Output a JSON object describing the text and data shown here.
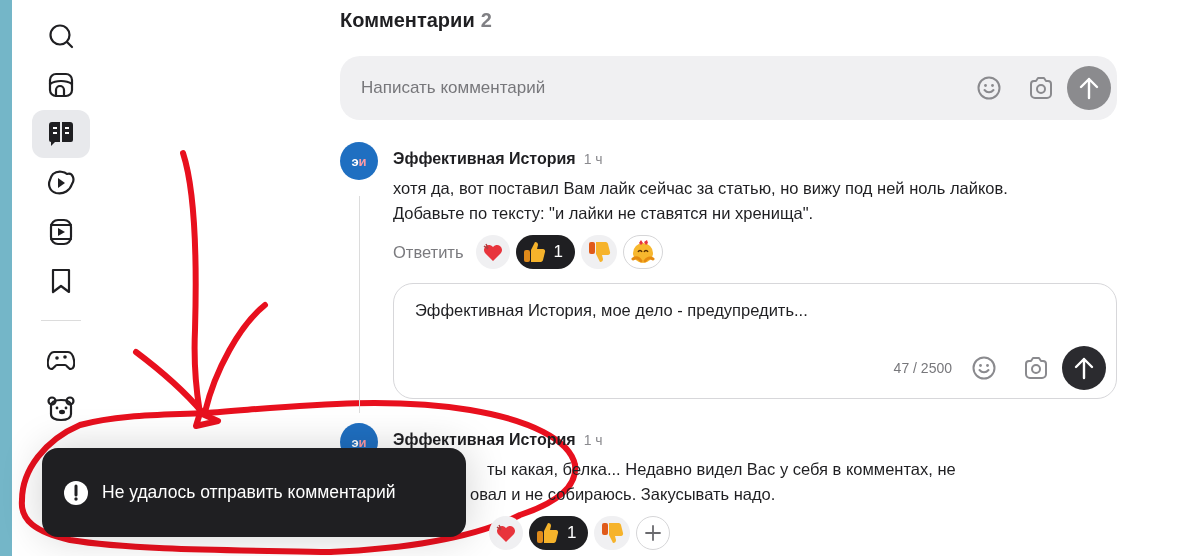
{
  "sidebar": {
    "items": [
      {
        "kind": "search",
        "selected": false
      },
      {
        "kind": "home",
        "selected": false
      },
      {
        "kind": "articles",
        "selected": true
      },
      {
        "kind": "video",
        "selected": false
      },
      {
        "kind": "shorts",
        "selected": false
      },
      {
        "kind": "bookmark",
        "selected": false
      },
      {
        "kind": "divider"
      },
      {
        "kind": "games",
        "selected": false
      },
      {
        "kind": "kids",
        "selected": false
      }
    ]
  },
  "comments_header": {
    "title": "Комментарии",
    "count": "2"
  },
  "comment_input": {
    "placeholder": "Написать комментарий"
  },
  "comments": [
    {
      "avatar_letters": [
        "э",
        "и"
      ],
      "author": "Эффективная История",
      "time": "1 ч",
      "lines": [
        "хотя да, вот поставил Вам лайк сейчас за статью, но вижу под ней ноль лайков.",
        "Добавьте по тексту: \"и лайки не ставятся ни хренища\"."
      ],
      "reply_label": "Ответить",
      "reactions": [
        {
          "kind": "heart",
          "selected": false
        },
        {
          "kind": "like",
          "selected": true,
          "count": "1"
        },
        {
          "kind": "dislike",
          "selected": false
        },
        {
          "kind": "hug",
          "selected": false
        }
      ],
      "reply_box": {
        "value": "Эффективная История, мое дело - предупредить...",
        "counter": "47 / 2500"
      }
    },
    {
      "avatar_letters": [
        "э",
        "и"
      ],
      "author": "Эффективная История",
      "time": "1 ч",
      "lines": [
        "ты какая, белка... Недавно видел Вас у себя в комментах, не",
        "овал и не собираюсь. Закусывать надо."
      ],
      "reactions": [
        {
          "kind": "heart",
          "selected": false
        },
        {
          "kind": "like",
          "selected": true,
          "count": "1"
        },
        {
          "kind": "dislike",
          "selected": false
        },
        {
          "kind": "add",
          "selected": false
        }
      ]
    }
  ],
  "toast": {
    "message": "Не удалось отправить комментарий"
  }
}
